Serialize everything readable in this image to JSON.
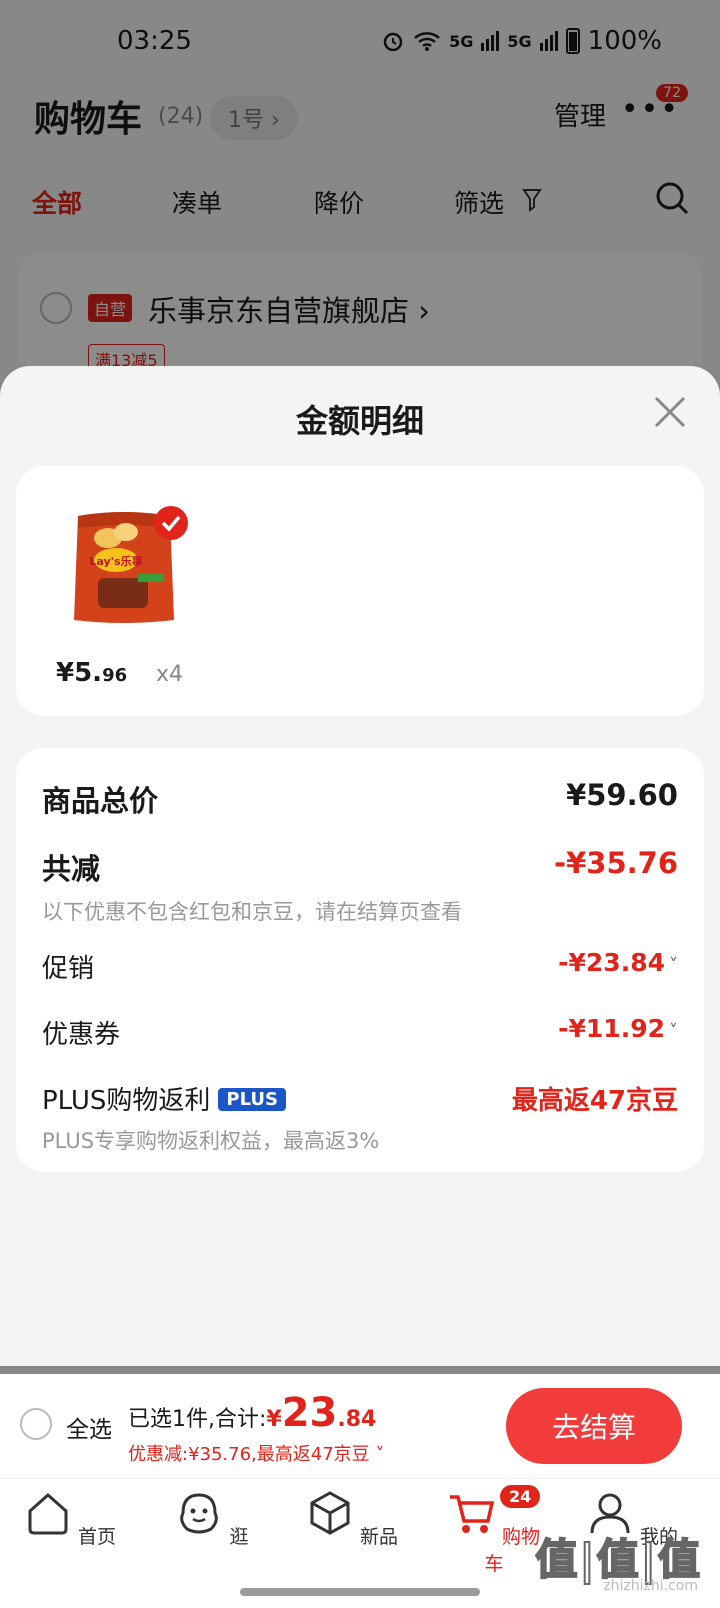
{
  "status_bar": {
    "time": "03:25",
    "battery": "100%",
    "signal1": "5G",
    "signal2": "5G"
  },
  "header": {
    "title": "购物车",
    "count": "(24)",
    "account": "1号 ›",
    "manage": "管理",
    "more_badge": "72"
  },
  "tabs": [
    {
      "label": "全部",
      "active": true
    },
    {
      "label": "凑单"
    },
    {
      "label": "降价"
    },
    {
      "label": "筛选"
    }
  ],
  "store": {
    "tag": "自营",
    "name": "乐事京东自营旗舰店 ›",
    "promo": "满13减5"
  },
  "sheet": {
    "title": "金额明细",
    "product": {
      "price_int": "¥5.",
      "price_dec": "96",
      "qty": "x4"
    },
    "total": {
      "label": "商品总价",
      "value": "¥59.60"
    },
    "reduce": {
      "label": "共减",
      "value": "-¥35.76",
      "note": "以下优惠不包含红包和京豆，请在结算页查看"
    },
    "promo": {
      "label": "促销",
      "value": "-¥23.84"
    },
    "coupon": {
      "label": "优惠券",
      "value": "-¥11.92"
    },
    "plus": {
      "label": "PLUS购物返利",
      "badge": "PLUS",
      "value": "最高返47京豆",
      "note": "PLUS专享购物返利权益，最高返3%"
    }
  },
  "checkout": {
    "select_all": "全选",
    "summary_prefix": "已选1件,合计:",
    "currency": "¥",
    "total_int": "23",
    "total_dec": ".84",
    "discount": "优惠减:¥35.76,最高返47京豆 ˅",
    "button": "去结算"
  },
  "nav": [
    {
      "label": "首页",
      "icon": "home-icon"
    },
    {
      "label": "逛",
      "icon": "browse-icon"
    },
    {
      "label": "新品",
      "icon": "box-icon"
    },
    {
      "label": "购物车",
      "icon": "cart-icon",
      "badge": "24",
      "active": true
    },
    {
      "label": "我的",
      "icon": "user-icon"
    }
  ],
  "watermark": {
    "text": "值|值|值",
    "url": "zhizhizhi.com"
  },
  "colors": {
    "accent": "#e2231a",
    "plus_blue": "#1a56c8",
    "button": "#f23c3c"
  }
}
